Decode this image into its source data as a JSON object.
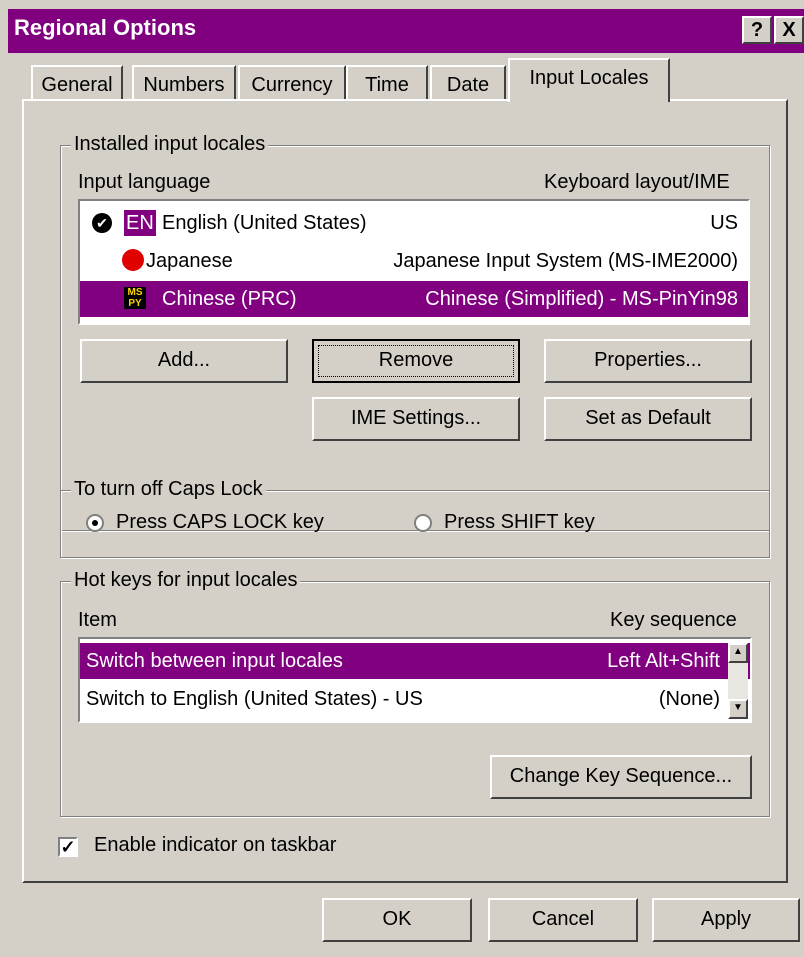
{
  "window": {
    "title": "Regional Options",
    "help_glyph": "?",
    "close_glyph": "X"
  },
  "tabs": [
    {
      "label": "General"
    },
    {
      "label": "Numbers"
    },
    {
      "label": "Currency"
    },
    {
      "label": "Time"
    },
    {
      "label": "Date"
    },
    {
      "label": "Input Locales"
    }
  ],
  "installed": {
    "group_label": "Installed input locales",
    "col_language": "Input language",
    "col_layout": "Keyboard layout/IME",
    "rows": [
      {
        "badge": "EN",
        "language": "English (United States)",
        "layout": "US",
        "selected": false,
        "default": true
      },
      {
        "language": "Japanese",
        "layout": "Japanese Input System (MS-IME2000)",
        "selected": false
      },
      {
        "language": "Chinese (PRC)",
        "layout": "Chinese (Simplified) - MS-PinYin98",
        "selected": true
      }
    ],
    "buttons": {
      "add": "Add...",
      "remove": "Remove",
      "properties": "Properties...",
      "ime_settings": "IME Settings...",
      "set_default": "Set as Default"
    }
  },
  "capslock": {
    "group_label": "To turn off Caps Lock",
    "opt_caps": "Press CAPS LOCK key",
    "opt_shift": "Press SHIFT key",
    "selected": "caps"
  },
  "hotkeys": {
    "group_label": "Hot keys for input locales",
    "col_item": "Item",
    "col_seq": "Key sequence",
    "rows": [
      {
        "item": "Switch between input locales",
        "seq": "Left Alt+Shift",
        "selected": true
      },
      {
        "item": "Switch to English (United States) - US",
        "seq": "(None)",
        "selected": false
      }
    ],
    "change_button": "Change Key Sequence..."
  },
  "indicator": {
    "label": "Enable indicator on taskbar",
    "checked": true
  },
  "footer": {
    "ok": "OK",
    "cancel": "Cancel",
    "apply": "Apply"
  },
  "colors": {
    "highlight": "#800080",
    "face": "#d4d0c8"
  }
}
